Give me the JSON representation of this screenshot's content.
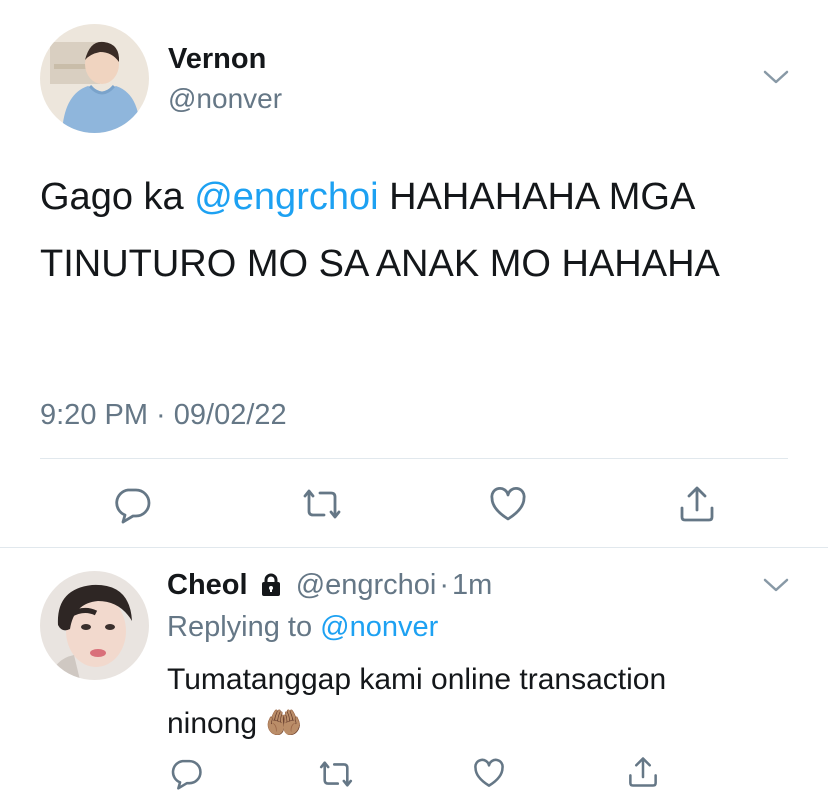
{
  "main_tweet": {
    "display_name": "Vernon",
    "handle": "@nonver",
    "text_prefix": "Gago ka ",
    "mention": "@engrchoi",
    "text_rest": " HAHAHAHA MGA TINUTURO MO SA ANAK MO HAHAHA",
    "timestamp": "9:20 PM · 09/02/22"
  },
  "reply_tweet": {
    "display_name": "Cheol",
    "handle": "@engrchoi",
    "separator": "·",
    "age": "1m",
    "replying_label": "Replying to ",
    "replying_to": "@nonver",
    "text": "Tumatanggap kami online transaction ninong 🤲🏽"
  },
  "icons": {
    "reply": "speech-bubble-icon",
    "retweet": "retweet-icon",
    "like": "heart-icon",
    "share": "share-icon",
    "more": "chevron-down-icon",
    "protected": "lock-icon"
  },
  "colors": {
    "text": "#14171a",
    "secondary": "#657786",
    "link": "#1da1f2",
    "divider": "#e1e8ed"
  }
}
